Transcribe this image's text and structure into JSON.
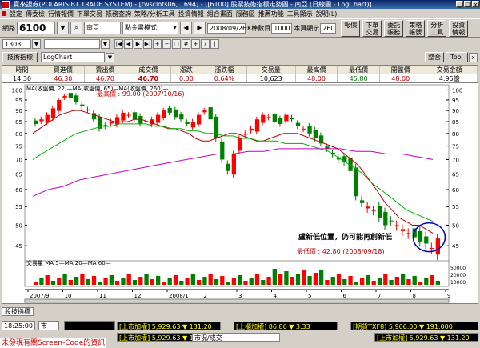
{
  "window": {
    "title": "寶來證券(POLARIS BT TRADE SYSTEM) - [twsclots06, 1694] - [[6100] 股票技術指標走勢圖 - 南亞 (日線圖 - LogChart)]",
    "buttons": [
      "_",
      "□",
      "x"
    ]
  },
  "menu": [
    "設定",
    "傳委檢",
    "行情報價",
    "下單交易",
    "帳務查詢",
    "策略/分析工具",
    "投資情報",
    "組合畫面",
    "服務區",
    "推薦功能",
    "工具顯示",
    "說明(L)"
  ],
  "toolbar": {
    "label": "網路",
    "code": "6100",
    "name": "南亞",
    "mode": "點金畫模式",
    "date_field": "2008/09/26",
    "kline_label": "K棒數目",
    "kline_count": "1000",
    "display_label": "本頁顯示",
    "display_count": "260",
    "buttons": [
      {
        "id": "report",
        "label": "報價"
      },
      {
        "id": "order",
        "label": "下單交易"
      },
      {
        "id": "account",
        "label": "委託帳務"
      },
      {
        "id": "strategy",
        "label": "策略帳號"
      },
      {
        "id": "analysis",
        "label": "分析工具"
      },
      {
        "id": "info",
        "label": "投資情報"
      }
    ]
  },
  "panel": {
    "index_field": "1303",
    "param_field": "",
    "indicator_button": "技術指標",
    "chart_type": "LogChart",
    "right_buttons": [
      "整合",
      "Tool"
    ]
  },
  "quote_header": {
    "columns": [
      "時間",
      "買進價",
      "賣出價",
      "成交價",
      "漲跌",
      "漲跌幅",
      "交易量",
      "最高價",
      "最低價",
      "開盤價",
      "交易金額"
    ],
    "values": [
      "14:30",
      "46.30",
      "46.70",
      "46.70",
      "0.30",
      "0.64%",
      "10,623",
      "48.00",
      "45.80",
      "48.00",
      "4.95億"
    ]
  },
  "chart_data": {
    "type": "candlestick",
    "legend": "MA(收盤價, 22)—MA(收盤價, 65)—MA(收盤價, 260)—",
    "high_label": "最高價 : 99.00 (2007/10/16)",
    "low_label": "最低價 : 42.80 (2008/09/18)",
    "annotation": "盧新低位置，仍可能再創新低",
    "y_ticks": [
      100,
      95,
      90,
      85,
      80,
      75,
      70,
      65,
      60,
      55,
      50,
      45
    ],
    "ylim": [
      42,
      101
    ],
    "x_ticks": [
      "2007/9",
      "10",
      "11",
      "12",
      "2008/1",
      "2",
      "3",
      "4",
      "5",
      "6",
      "7",
      "8",
      "9"
    ],
    "volume_legend": "交易量 MA   5—MA 20—MA 60—",
    "volume_ticks": [
      "50000",
      "20000",
      "10000"
    ],
    "close_points": [
      84,
      86,
      88,
      91,
      95,
      97,
      96,
      94,
      92,
      90,
      86,
      82,
      83,
      85,
      87,
      89,
      88,
      86,
      84,
      85,
      86,
      88,
      90,
      89,
      87,
      86,
      84,
      85,
      88,
      90,
      86,
      78,
      70,
      66,
      72,
      78,
      80,
      82,
      86,
      88,
      87,
      85,
      84,
      88,
      86,
      83,
      82,
      80,
      78,
      76,
      74,
      72,
      70,
      69,
      66,
      58,
      56,
      55,
      54,
      52,
      50,
      51,
      50,
      49,
      48,
      47,
      46,
      45.5,
      44.5,
      46.7
    ],
    "ma22": [
      80,
      82,
      84,
      86,
      88,
      89,
      90,
      90,
      89,
      88,
      87,
      86,
      85,
      85,
      85,
      86,
      86,
      85,
      84,
      83,
      82,
      82,
      81,
      80,
      78,
      77,
      77,
      78,
      79,
      80,
      80,
      79,
      78,
      77,
      77,
      78,
      79,
      80,
      80,
      80,
      79,
      78,
      77,
      76,
      75,
      74,
      72,
      70,
      68,
      65,
      62,
      59,
      56,
      54,
      52,
      51,
      50,
      50,
      49,
      48
    ],
    "ma65": [
      70,
      72,
      74,
      76,
      78,
      80,
      81,
      82,
      83,
      83,
      84,
      84,
      84,
      84,
      83,
      83,
      82,
      82,
      81,
      81,
      80,
      80,
      79,
      79,
      78,
      78,
      77,
      77,
      77,
      76,
      76,
      76,
      75,
      74,
      73,
      71,
      69,
      67,
      65,
      62,
      60,
      58,
      56,
      54,
      53,
      52,
      51
    ],
    "ma260": [
      58,
      60,
      61,
      63,
      64,
      65,
      66,
      67,
      68,
      69,
      70,
      71,
      72,
      72,
      73,
      73,
      74,
      74,
      74,
      74,
      74,
      73,
      73,
      72,
      72,
      71,
      70
    ]
  },
  "bottom": {
    "tab": "股技指標",
    "time": "18:25:00",
    "market_combo": "市",
    "quotes": [
      "[上市加權] 5,929.63 ▼ 131.20",
      "[上櫃加權] 86.86 ▼ 3.33",
      "[期貨TXF8] 5,906.00 ▼ 191.000"
    ],
    "quotes2": [
      "[上市加權] 5,929.63 ▼ 131.20",
      "市況/成交",
      "[上市加權] 5,929.63 ▼ 131.20"
    ],
    "status": "未發現有關Screen-Code的資訊"
  },
  "colors": {
    "up": "#ff0000",
    "down": "#008000",
    "ma22": "#c00000",
    "ma65": "#00b000",
    "ma260": "#c000c0"
  }
}
